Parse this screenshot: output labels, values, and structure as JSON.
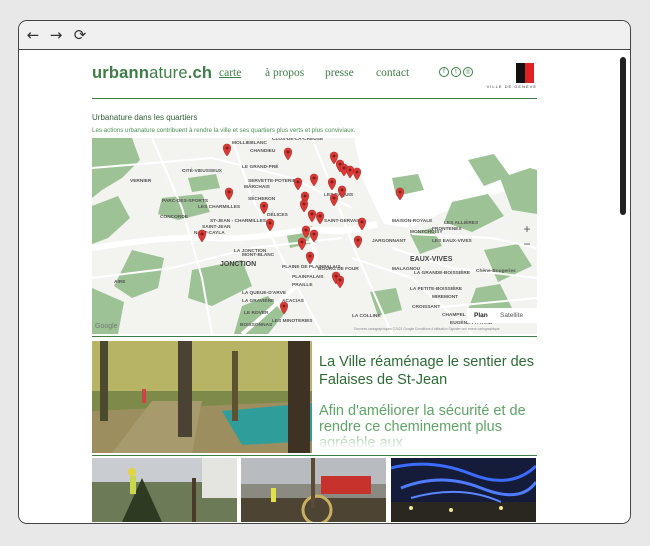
{
  "browser": {
    "back_icon": "←",
    "forward_icon": "→",
    "reload_icon": "⟳"
  },
  "site": {
    "logo_bold_a": "urban",
    "logo_regular": "ature",
    "logo_bold_b": ".ch",
    "logo_n": "n",
    "nav": [
      "carte",
      "à propos",
      "presse",
      "contact"
    ],
    "social_icons": [
      "facebook-icon",
      "twitter-icon",
      "instagram-icon"
    ],
    "social_glyphs": [
      "f",
      "t",
      "◎"
    ],
    "ville_text": "VILLE DE GENÈVE"
  },
  "section": {
    "title": "Urbanature dans les quartiers",
    "intro": "Les actions urbanature contribuent à rendre la ville et ses quartiers plus verts et plus conviviaux."
  },
  "map": {
    "zoom_in": "+",
    "zoom_out": "−",
    "type_plan": "Plan",
    "type_satellite": "Satellite",
    "google": "Google",
    "credit": "Données cartographiques ©2021 Google   Conditions d'utilisation   Signaler une erreur cartographique",
    "labels": [
      "MONT-BLANC",
      "ST-JEAN - CHARMILLES",
      "PLAINPALAIS",
      "EAUX-VIVES",
      "JONCTION",
      "LES PÂQUIS",
      "CHAMPEL",
      "CHANDIEU",
      "MOLLIEBLANC",
      "CITÉ-VIEUSSEUX",
      "LE GRAND-PRÉ",
      "SERVETTE-POTERIE",
      "SÉCHERON",
      "PARC-DES-SPORTS",
      "LES CHARMILLES",
      "CONCORDE",
      "NANT-CAYLA",
      "DÉLICES",
      "SAINT-GERVAIS",
      "JARGONNANT",
      "MAISON-ROYALE",
      "MONTCHOISY",
      "LES ALLIÈRES",
      "LA GRANDE-BOISSIÈRE",
      "LA PETITE-BOISSIÈRE",
      "MIREMONT",
      "CROISSANT",
      "LA COLLINE",
      "EUGÈNE-PITTARD",
      "LES MINOTERIES",
      "BOISSONNAS",
      "LA GRAVIÈRE",
      "LA QUEUE-D'ARVE",
      "ACACIAS",
      "AIRE",
      "CLOS-DE-LA-CREUSE",
      "LA JONCTION",
      "VERNIER",
      "Chêne-Bougeries",
      "PRAILLE",
      "SAINT-JEAN",
      "MÂRCHAIS",
      "FRONTENEX",
      "PLAINE DE PLAINPALAIS",
      "LE ROVER",
      "BOURG DE FOUR",
      "MALAGNOU",
      "LES EAUX-VIVES"
    ],
    "marker_color": "#d93a36"
  },
  "article": {
    "title": "La Ville réaménage le sentier des Falaises de St-Jean",
    "subtitle": "Afin d'améliorer la sécurité et de rendre ce cheminement plus agréable aux"
  },
  "colors": {
    "brand": "#3d7e46",
    "brand_light": "#5ea465",
    "map_green": "#9dc295"
  }
}
